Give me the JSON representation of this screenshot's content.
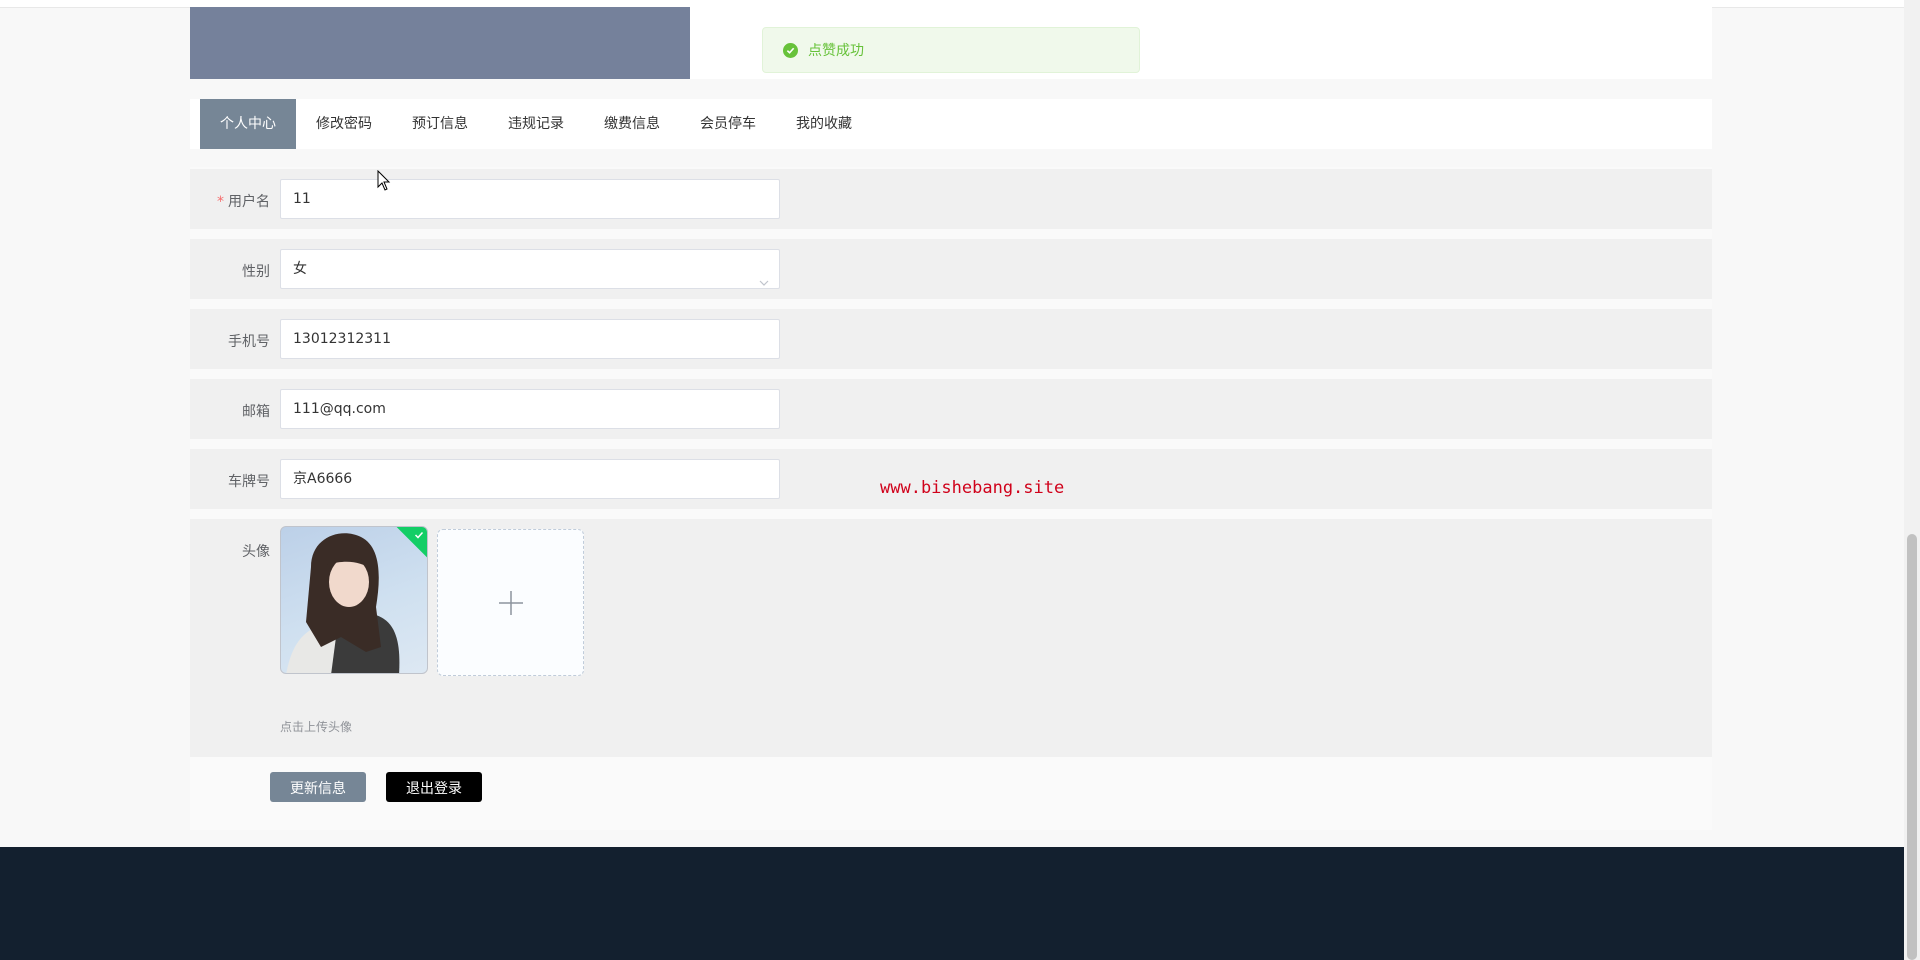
{
  "toast": {
    "message": "点赞成功",
    "color": "#67c23a"
  },
  "tabs": [
    {
      "label": "个人中心",
      "active": true
    },
    {
      "label": "修改密码",
      "active": false
    },
    {
      "label": "预订信息",
      "active": false
    },
    {
      "label": "违规记录",
      "active": false
    },
    {
      "label": "缴费信息",
      "active": false
    },
    {
      "label": "会员停车",
      "active": false
    },
    {
      "label": "我的收藏",
      "active": false
    }
  ],
  "form": {
    "username": {
      "label": "用户名",
      "required_mark": "*",
      "value": "11"
    },
    "gender": {
      "label": "性别",
      "value": "女"
    },
    "phone": {
      "label": "手机号",
      "value": "13012312311"
    },
    "email": {
      "label": "邮箱",
      "value": "111@qq.com"
    },
    "plate": {
      "label": "车牌号",
      "value": "京A6666"
    },
    "avatar": {
      "label": "头像",
      "tip": "点击上传头像"
    }
  },
  "buttons": {
    "update": "更新信息",
    "logout": "退出登录"
  },
  "watermark": "www.bishebang.site",
  "colors": {
    "accent": "#768696",
    "banner": "#75819b",
    "footer": "#13202f",
    "logout_bg": "#000000"
  }
}
